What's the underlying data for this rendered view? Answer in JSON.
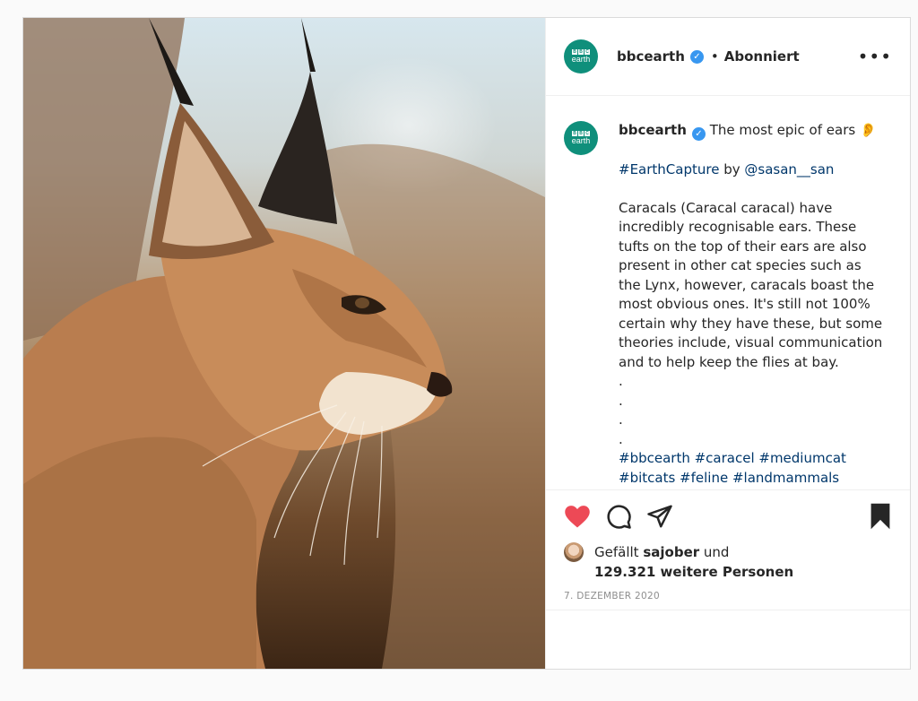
{
  "post": {
    "author": {
      "username": "bbcearth",
      "avatar_text_top": [
        "B",
        "B",
        "C"
      ],
      "avatar_text_bottom": "earth",
      "verified": true,
      "follow_status": "Abonniert"
    },
    "caption": {
      "line1": "The most epic of ears 👂",
      "line2_hashtag": "#EarthCapture",
      "line2_by": "by",
      "line2_mention": "@sasan__san",
      "paragraph": "Caracals (Caracal caracal) have incredibly recognisable ears. These tufts on the top of their ears are also present in other cat species such as the Lynx, however, caracals boast the most obvious ones. It's still not 100% certain why they have these, but some theories include, visual communication and to help keep the flies at bay.",
      "dots": [
        ".",
        ".",
        ".",
        "."
      ],
      "hashtags_line1": "#bbcearth #caracel #mediumcat",
      "hashtags_line2": "#bitcats #feline #landmammals"
    },
    "actions": {
      "like_icon": "heart-filled-icon",
      "comment_icon": "comment-icon",
      "share_icon": "share-icon",
      "save_icon": "bookmark-filled-icon"
    },
    "likes": {
      "prefix": "Gefällt",
      "liker": "sajober",
      "joiner": "und",
      "count_text": "129.321 weitere Personen"
    },
    "date": "7. Dezember 2020",
    "colors": {
      "heart": "#ed4956",
      "brand": "#0f8f7b",
      "verified": "#3897f0",
      "link": "#00376b"
    }
  }
}
